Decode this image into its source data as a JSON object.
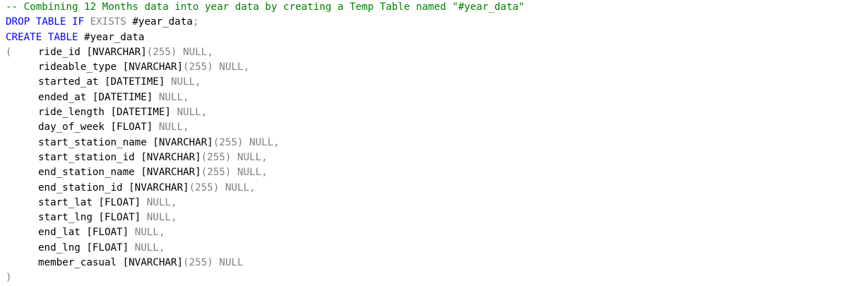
{
  "editor": {
    "comment": "-- Combining 12 Months data into year data by creating a Temp Table named \"#year_data\"",
    "drop": {
      "kw1": "DROP TABLE IF",
      "kw2": "EXISTS",
      "ident": "#year_data",
      "semi": ";"
    },
    "create": {
      "kw": "CREATE TABLE",
      "ident": "#year_data"
    },
    "open_paren": "(",
    "close_paren": ")",
    "columns": [
      {
        "name": "ride_id",
        "type": "[NVARCHAR]",
        "size": "(255)",
        "null": "NULL",
        "comma": ","
      },
      {
        "name": "rideable_type",
        "type": "[NVARCHAR]",
        "size": "(255)",
        "null": "NULL",
        "comma": ","
      },
      {
        "name": "started_at",
        "type": "[DATETIME]",
        "size": "",
        "null": "NULL",
        "comma": ","
      },
      {
        "name": "ended_at",
        "type": "[DATETIME]",
        "size": "",
        "null": "NULL",
        "comma": ","
      },
      {
        "name": "ride_length",
        "type": "[DATETIME]",
        "size": "",
        "null": "NULL",
        "comma": ","
      },
      {
        "name": "day_of_week",
        "type": "[FLOAT]",
        "size": "",
        "null": "NULL",
        "comma": ","
      },
      {
        "name": "start_station_name",
        "type": "[NVARCHAR]",
        "size": "(255)",
        "null": "NULL",
        "comma": ","
      },
      {
        "name": "start_station_id",
        "type": "[NVARCHAR]",
        "size": "(255)",
        "null": "NULL",
        "comma": ","
      },
      {
        "name": "end_station_name",
        "type": "[NVARCHAR]",
        "size": "(255)",
        "null": "NULL",
        "comma": ","
      },
      {
        "name": "end_station_id",
        "type": "[NVARCHAR]",
        "size": "(255)",
        "null": "NULL",
        "comma": ","
      },
      {
        "name": "start_lat",
        "type": "[FLOAT]",
        "size": "",
        "null": "NULL",
        "comma": ","
      },
      {
        "name": "start_lng",
        "type": "[FLOAT]",
        "size": "",
        "null": "NULL",
        "comma": ","
      },
      {
        "name": "end_lat",
        "type": "[FLOAT]",
        "size": "",
        "null": "NULL",
        "comma": ","
      },
      {
        "name": "end_lng",
        "type": "[FLOAT]",
        "size": "",
        "null": "NULL",
        "comma": ","
      },
      {
        "name": "member_casual",
        "type": "[NVARCHAR]",
        "size": "(255)",
        "null": "NULL",
        "comma": ""
      }
    ],
    "colors": {
      "comment": "#008000",
      "keyword": "#0000ff",
      "punctuation": "#808080",
      "identifier": "#000000"
    }
  }
}
